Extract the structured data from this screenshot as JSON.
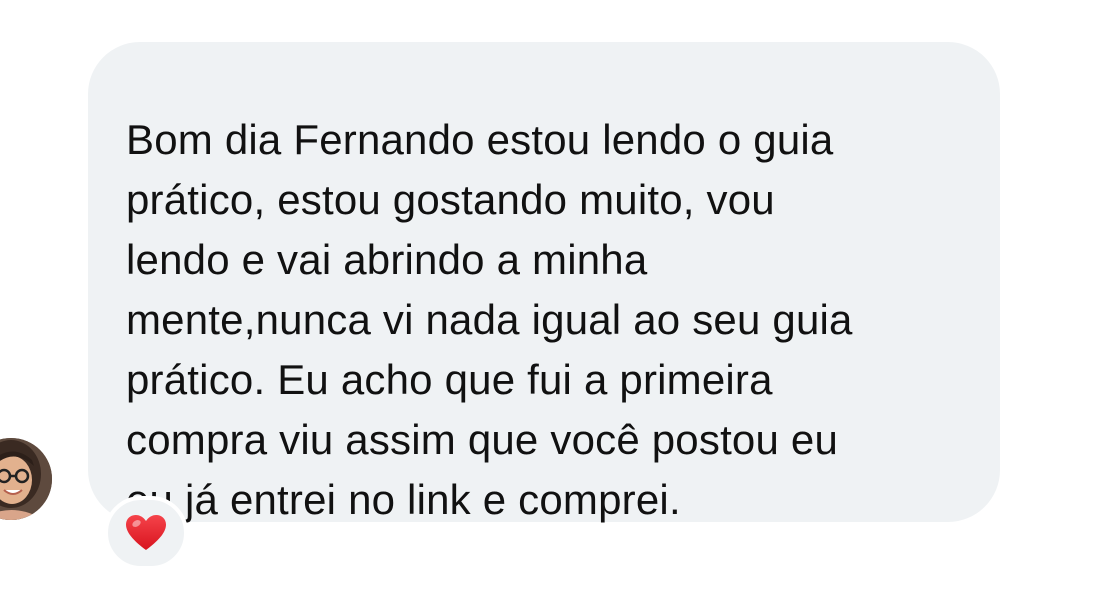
{
  "message": {
    "text": "Bom dia Fernando estou lendo o guia\nprático, estou gostando muito, vou\nlendo e vai abrindo a minha\nmente,nunca vi nada igual ao seu guia\nprático. Eu acho que fui a primeira\ncompra viu assim que você postou eu\neu já entrei no link e comprei."
  },
  "reaction": {
    "icon": "red-heart-icon",
    "color": "#e8202a"
  },
  "sender": {
    "avatar_icon": "user-avatar"
  },
  "colors": {
    "bubble": "#eff2f4",
    "text": "#111111"
  }
}
